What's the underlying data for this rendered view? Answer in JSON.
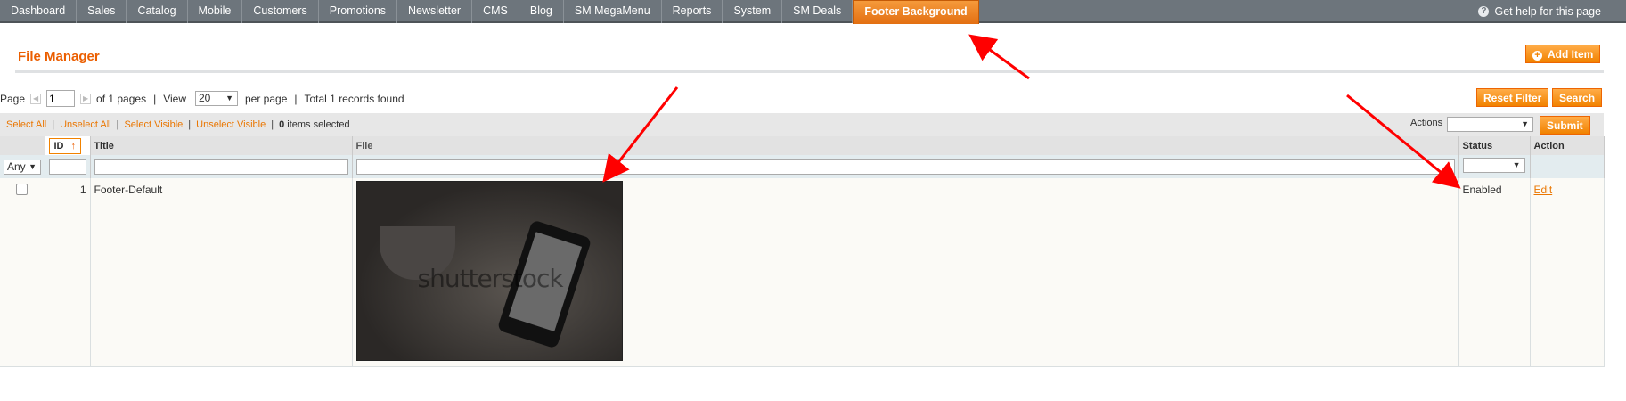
{
  "nav": {
    "items": [
      "Dashboard",
      "Sales",
      "Catalog",
      "Mobile",
      "Customers",
      "Promotions",
      "Newsletter",
      "CMS",
      "Blog",
      "SM MegaMenu",
      "Reports",
      "System",
      "SM Deals",
      "Footer Background"
    ],
    "active": "Footer Background",
    "help": "Get help for this page",
    "help_icon": "question-icon"
  },
  "header": {
    "title": "File Manager",
    "add_button": "Add Item",
    "add_icon": "plus-circle-icon"
  },
  "pager": {
    "page_label": "Page",
    "page_value": "1",
    "of_pages": "of 1 pages",
    "view_label": "View",
    "per_page_value": "20",
    "per_page_label": "per page",
    "total": "Total 1 records found"
  },
  "filter_buttons": {
    "reset": "Reset Filter",
    "search": "Search"
  },
  "massaction": {
    "select_all": "Select All",
    "unselect_all": "Unselect All",
    "select_visible": "Select Visible",
    "unselect_visible": "Unselect Visible",
    "count": "0",
    "selected_label": "items selected",
    "actions_label": "Actions",
    "actions_value": "",
    "submit": "Submit"
  },
  "grid": {
    "columns": {
      "id": "ID",
      "title": "Title",
      "file": "File",
      "status": "Status",
      "action": "Action"
    },
    "filter_any": "Any",
    "rows": [
      {
        "id": "1",
        "title": "Footer-Default",
        "image_watermark": "shutterstock",
        "status": "Enabled",
        "action": "Edit"
      }
    ]
  },
  "colors": {
    "accent": "#eb5e00",
    "button": "#f18200",
    "nav": "#6d757c",
    "annotation": "#ff0000"
  }
}
